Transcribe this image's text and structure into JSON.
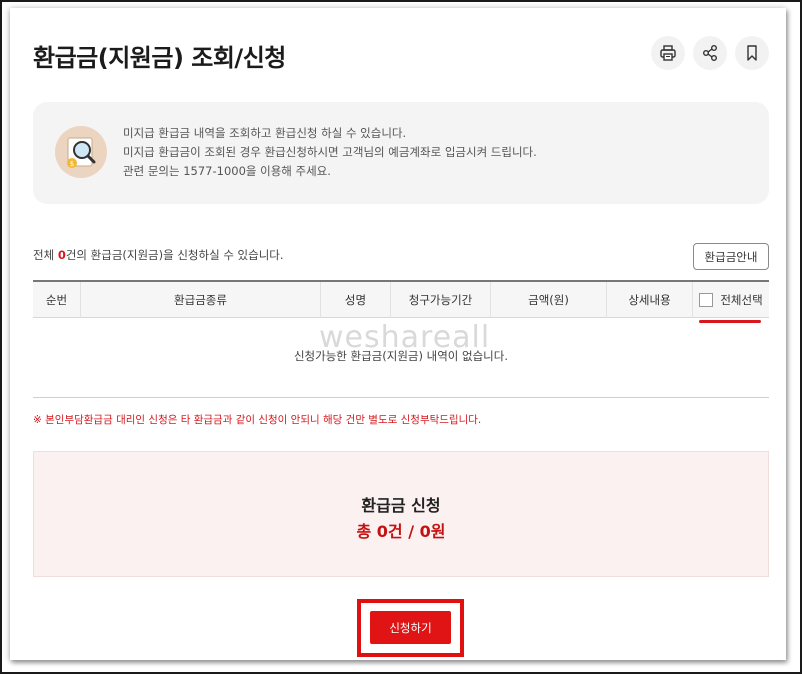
{
  "page": {
    "title": "환급금(지원금) 조회/신청"
  },
  "toolbar": {
    "icons": [
      "print-icon",
      "share-icon",
      "bookmark-icon"
    ]
  },
  "info": {
    "lines": [
      "미지급 환급금 내역을 조회하고 환급신청 하실 수 있습니다.",
      "미지급 환급금이 조회된 경우 환급신청하시면 고객님의 예금계좌로 입금시켜 드립니다.",
      "관련 문의는 1577-1000을 이용해 주세요."
    ]
  },
  "summary": {
    "prefix": "전체 ",
    "count": "0",
    "suffix": "건의 환급금(지원금)을 신청하실 수 있습니다."
  },
  "guide_button": "환급금안내",
  "table": {
    "columns": [
      "순번",
      "환급금종류",
      "성명",
      "청구가능기간",
      "금액(원)",
      "상세내용",
      "전체선택"
    ],
    "empty_message": "신청가능한 환급금(지원금) 내역이 없습니다."
  },
  "watermark": "weshareall",
  "notice": "※ 본인부담환급금 대리인 신청은 타 환급금과 같이 신청이 안되니 해당 건만 별도로 신청부탁드립니다.",
  "apply": {
    "title": "환급금 신청",
    "total": "총 0건 / 0원",
    "button": "신청하기"
  },
  "colors": {
    "accent": "#e01414",
    "highlight_outline": "#e01010"
  }
}
